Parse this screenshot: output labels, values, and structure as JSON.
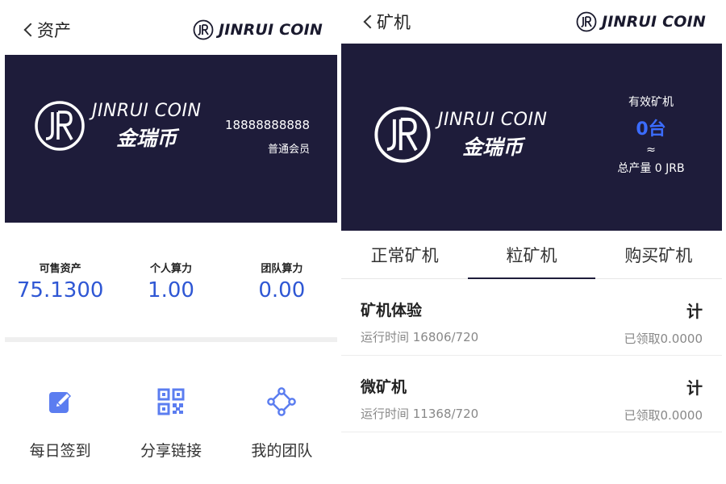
{
  "left": {
    "header": {
      "back_label": "资产",
      "brand": "JINRUI COIN"
    },
    "banner": {
      "logo_en": "JINRUI COIN",
      "logo_cn": "金瑞币",
      "phone": "18888888888",
      "member_level": "普通会员"
    },
    "stats": [
      {
        "label": "可售资产",
        "value": "75.1300"
      },
      {
        "label": "个人算力",
        "value": "1.00"
      },
      {
        "label": "团队算力",
        "value": "0.00"
      }
    ],
    "shortcuts": [
      {
        "label": "每日签到",
        "icon": "edit-icon"
      },
      {
        "label": "分享链接",
        "icon": "qrcode-icon"
      },
      {
        "label": "我的团队",
        "icon": "team-icon"
      }
    ]
  },
  "right": {
    "header": {
      "back_label": "矿机",
      "brand": "JINRUI COIN"
    },
    "banner": {
      "logo_en": "JINRUI COIN",
      "logo_cn": "金瑞币",
      "valid_label": "有效矿机",
      "valid_count": "0台",
      "approx": "≈",
      "total": "总产量 0 JRB"
    },
    "tabs": [
      {
        "label": "正常矿机",
        "active": false
      },
      {
        "label": "粒矿机",
        "active": true
      },
      {
        "label": "购买矿机",
        "active": false
      }
    ],
    "items": [
      {
        "name": "矿机体验",
        "runtime": "运行时间 16806/720",
        "unit": "计",
        "claimed": "已领取0.0000"
      },
      {
        "name": "微矿机",
        "runtime": "运行时间 11368/720",
        "unit": "计",
        "claimed": "已领取0.0000"
      }
    ]
  },
  "colors": {
    "banner_bg": "#1e1c3a",
    "accent_blue": "#2f57d4",
    "count_blue": "#3b6cff"
  }
}
